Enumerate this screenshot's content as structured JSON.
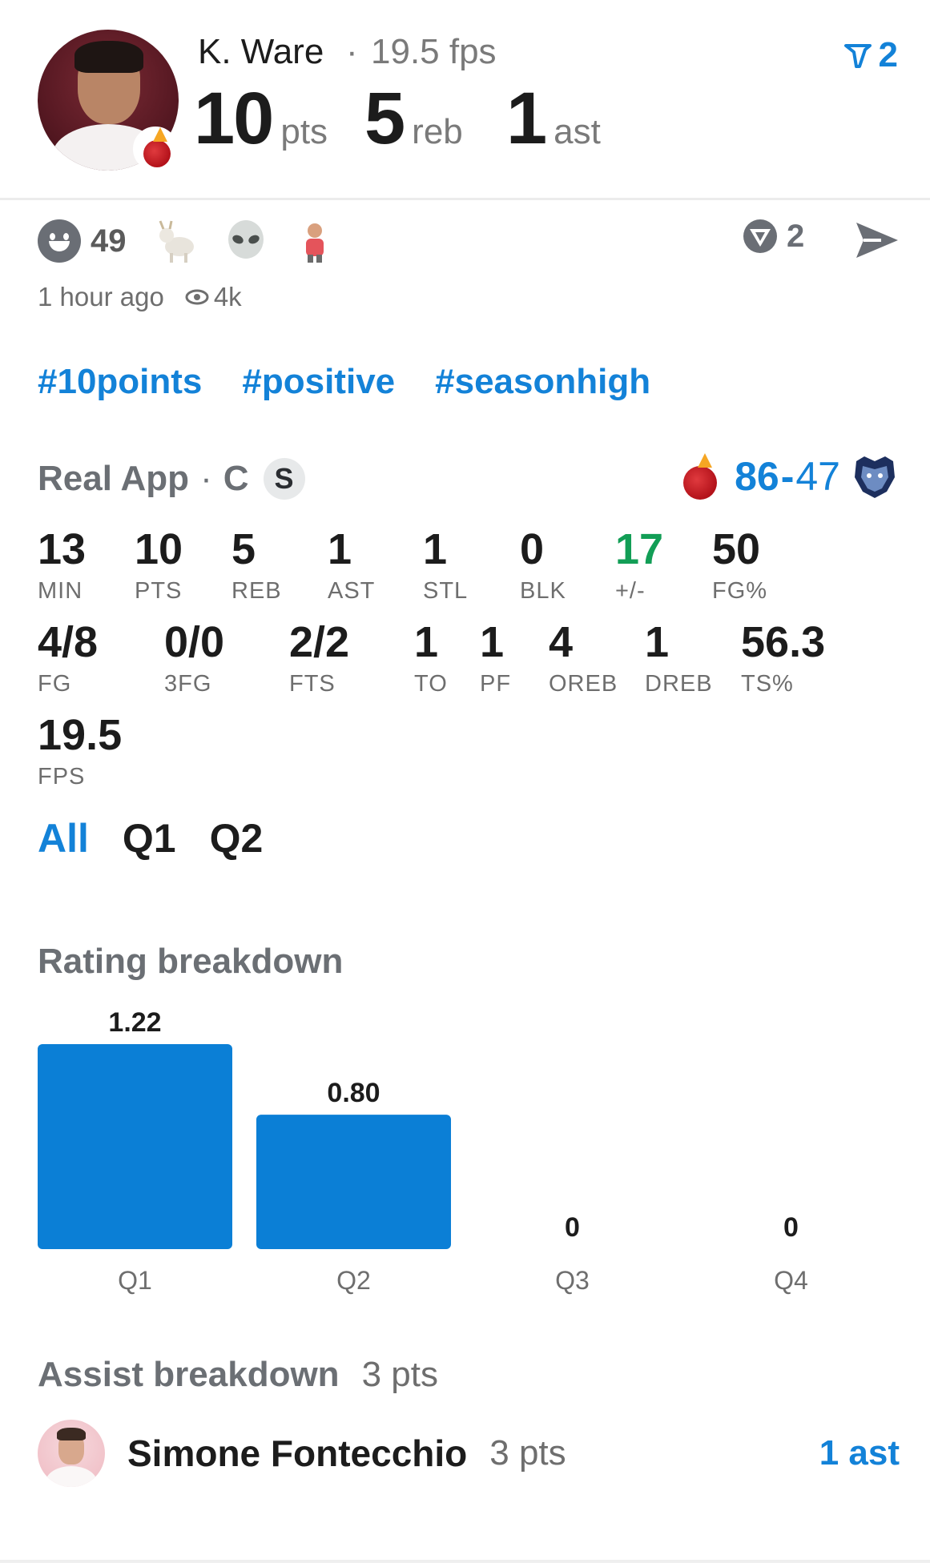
{
  "header": {
    "player_name": "K. Ware",
    "separator": "·",
    "fps_label": "19.5 fps",
    "points": "10",
    "points_unit": "pts",
    "rebounds": "5",
    "rebounds_unit": "reb",
    "assists": "1",
    "assists_unit": "ast",
    "vote_count": "2"
  },
  "reactions": {
    "smile_count": "49",
    "emojis": [
      "goat-emoji",
      "alien-emoji",
      "player-sticker"
    ],
    "reply_count": "2",
    "posted": "1 hour ago",
    "views": "4k"
  },
  "hashtags": [
    "#10points",
    "#positive",
    "#seasonhigh"
  ],
  "game": {
    "source": "Real App",
    "separator": "·",
    "position": "C",
    "badge": "S",
    "home_score": "86",
    "dash": "-",
    "away_score": "47",
    "home_team_icon": "heat-logo",
    "away_team_icon": "grizzlies-logo"
  },
  "box_score": [
    {
      "label": "MIN",
      "value": "13"
    },
    {
      "label": "PTS",
      "value": "10"
    },
    {
      "label": "REB",
      "value": "5"
    },
    {
      "label": "AST",
      "value": "1"
    },
    {
      "label": "STL",
      "value": "1"
    },
    {
      "label": "BLK",
      "value": "0"
    },
    {
      "label": "+/-",
      "value": "17",
      "color": "#129e56"
    },
    {
      "label": "FG%",
      "value": "50"
    },
    {
      "label": "FG",
      "value": "4/8"
    },
    {
      "label": "3FG",
      "value": "0/0"
    },
    {
      "label": "FTS",
      "value": "2/2"
    },
    {
      "label": "TO",
      "value": "1"
    },
    {
      "label": "PF",
      "value": "1"
    },
    {
      "label": "OREB",
      "value": "4"
    },
    {
      "label": "DREB",
      "value": "1"
    },
    {
      "label": "TS%",
      "value": "56.3"
    },
    {
      "label": "FPS",
      "value": "19.5"
    }
  ],
  "quarter_tabs": {
    "items": [
      "All",
      "Q1",
      "Q2"
    ],
    "active": "All"
  },
  "rating": {
    "title": "Rating breakdown"
  },
  "chart_data": {
    "type": "bar",
    "categories": [
      "Q1",
      "Q2",
      "Q3",
      "Q4"
    ],
    "values": [
      1.22,
      0.8,
      0,
      0
    ],
    "value_labels": [
      "1.22",
      "0.80",
      "0",
      "0"
    ],
    "title": "Rating breakdown",
    "xlabel": "",
    "ylabel": "",
    "ylim": [
      0,
      1.22
    ],
    "grid": false,
    "color": "#0b7fd6"
  },
  "assists_section": {
    "title": "Assist breakdown",
    "total": "3 pts",
    "rows": [
      {
        "name": "Simone Fontecchio",
        "pts": "3 pts",
        "ast": "1 ast"
      }
    ]
  },
  "colors": {
    "accent": "#1382d8",
    "positive": "#129e56",
    "bar": "#0b7fd6"
  }
}
